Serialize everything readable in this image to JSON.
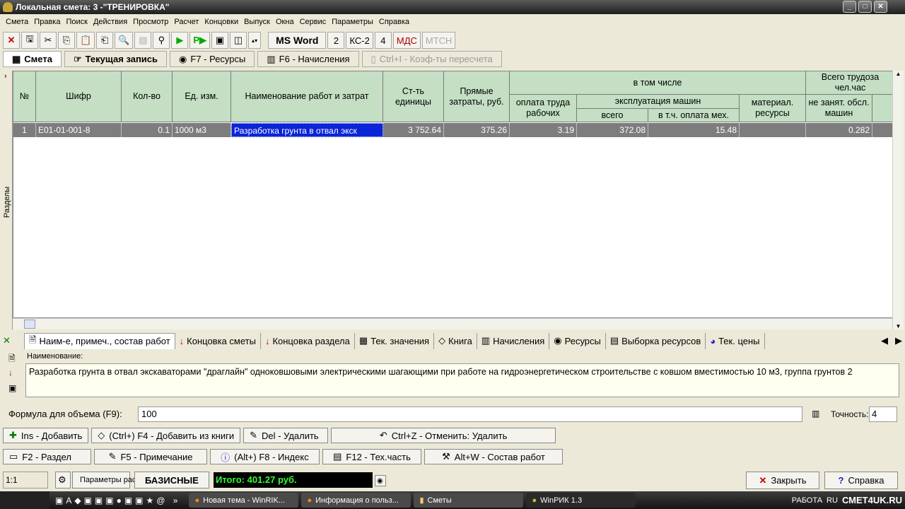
{
  "window": {
    "title": "Локальная смета: 3 -\"ТРЕНИРОВКА\""
  },
  "menu": [
    "Смета",
    "Правка",
    "Поиск",
    "Действия",
    "Просмотр",
    "Расчет",
    "Концовки",
    "Выпуск",
    "Окна",
    "Сервис",
    "Параметры",
    "Справка"
  ],
  "toolbar": {
    "ms_word": "MS Word",
    "b2": "2",
    "ks2": "КС-2",
    "b4": "4",
    "mds": "МДС",
    "mtsn": "МТСН"
  },
  "tabs": [
    {
      "label": "Смета",
      "active": true
    },
    {
      "label": "Текущая запись"
    },
    {
      "label": "F7 - Ресурсы"
    },
    {
      "label": "F6 - Начисления"
    },
    {
      "label": "Ctrl+I - Коэф-ты пересчета",
      "disabled": true
    }
  ],
  "sidebar_label": "Разделы",
  "grid": {
    "headers": {
      "num": "№",
      "code": "Шифр",
      "qty": "Кол-во",
      "unit": "Ед. изм.",
      "name": "Наименование работ и затрат",
      "unit_cost": "Ст-ть единицы",
      "direct": "Прямые затраты, руб.",
      "incl": "в том числе",
      "labor": "оплата труда рабочих",
      "machines": "эксплуатация машин",
      "mach_total": "всего",
      "mach_labor": "в т.ч. оплата мех.",
      "materials": "материал. ресурсы",
      "labor_total": "Всего трудоза чел.час",
      "not_busy": "не занят. обсл. машин"
    },
    "rows": [
      {
        "num": "1",
        "code": "Е01-01-001-8",
        "qty": "0.1",
        "unit": "1000 м3",
        "name": "Разработка грунта в отвал экск",
        "unit_cost": "3 752.64",
        "direct": "375.26",
        "labor": "3.19",
        "mach_total": "372.08",
        "mach_labor": "15.48",
        "materials": "",
        "not_busy": "0.282"
      }
    ]
  },
  "bottom_tabs": [
    "Наим-е, примеч., состав работ",
    "Концовка сметы",
    "Концовка раздела",
    "Тек. значения",
    "Книга",
    "Начисления",
    "Ресурсы",
    "Выборка ресурсов",
    "Тек. цены"
  ],
  "name_label": "Наименование:",
  "name_text": "Разработка грунта в отвал экскаваторами \"драглайн\" одноковшовыми электрическими шагающими при работе на гидроэнергетическом строительстве с ковшом вместимостью 10 м3, группа грунтов 2",
  "formula": {
    "label": "Формула для объема (F9):",
    "value": "100",
    "precision_label": "Точность:",
    "precision": "4"
  },
  "actions1": [
    "Ins - Добавить",
    "(Ctrl+) F4 - Добавить из книги",
    "Del - Удалить",
    "Ctrl+Z - Отменить: Удалить"
  ],
  "actions2": [
    "F2 - Раздел",
    "F5 - Примечание",
    "(Alt+) F8 - Индекс",
    "F12 - Тех.часть",
    "Alt+W - Состав работ"
  ],
  "status": {
    "scale": "1:1",
    "params": "Параметры расчета",
    "mode": "БАЗИСНЫЕ",
    "total": "Итого: 401.27 руб.",
    "close": "Закрыть",
    "help": "Справка"
  },
  "taskbar": {
    "tasks": [
      "Новая тема - WinRIK...",
      "Информация о польз...",
      "Сметы",
      "WinРИК 1.3"
    ],
    "tray": "РАБОТА",
    "lang": "RU",
    "watermark": "СМЕТ4UK.RU"
  }
}
